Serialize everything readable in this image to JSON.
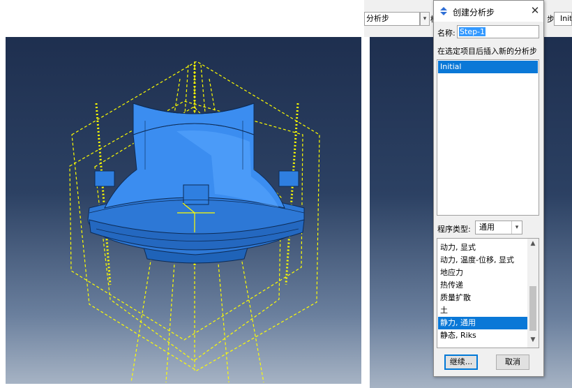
{
  "toolbar": {
    "step_combo_value": "分析步",
    "partial_label_1": "模",
    "partial_label_2": "步:",
    "step_value_right": "Init"
  },
  "dialog": {
    "title": "创建分析步",
    "close_glyph": "✕",
    "name_label": "名称:",
    "name_value": "Step-1",
    "insert_after_label": "在选定项目后插入新的分析步",
    "steps": [
      "Initial"
    ],
    "selected_step": "Initial",
    "procedure_type_label": "程序类型:",
    "procedure_type_value": "通用",
    "procedures": [
      "动力, 显式",
      "动力, 温度-位移, 显式",
      "地应力",
      "热传递",
      "质量扩散",
      "土",
      "静力, 通用",
      "静态, Riks"
    ],
    "selected_procedure": "静力, 通用",
    "continue_label": "继续...",
    "cancel_label": "取消"
  },
  "colors": {
    "viewport_top": "#1e2f4f",
    "viewport_bottom": "#a6b3c4",
    "part_blue": "#2f7fe0",
    "datum_yellow": "#ffff00",
    "selection_blue": "#0a78d7"
  }
}
